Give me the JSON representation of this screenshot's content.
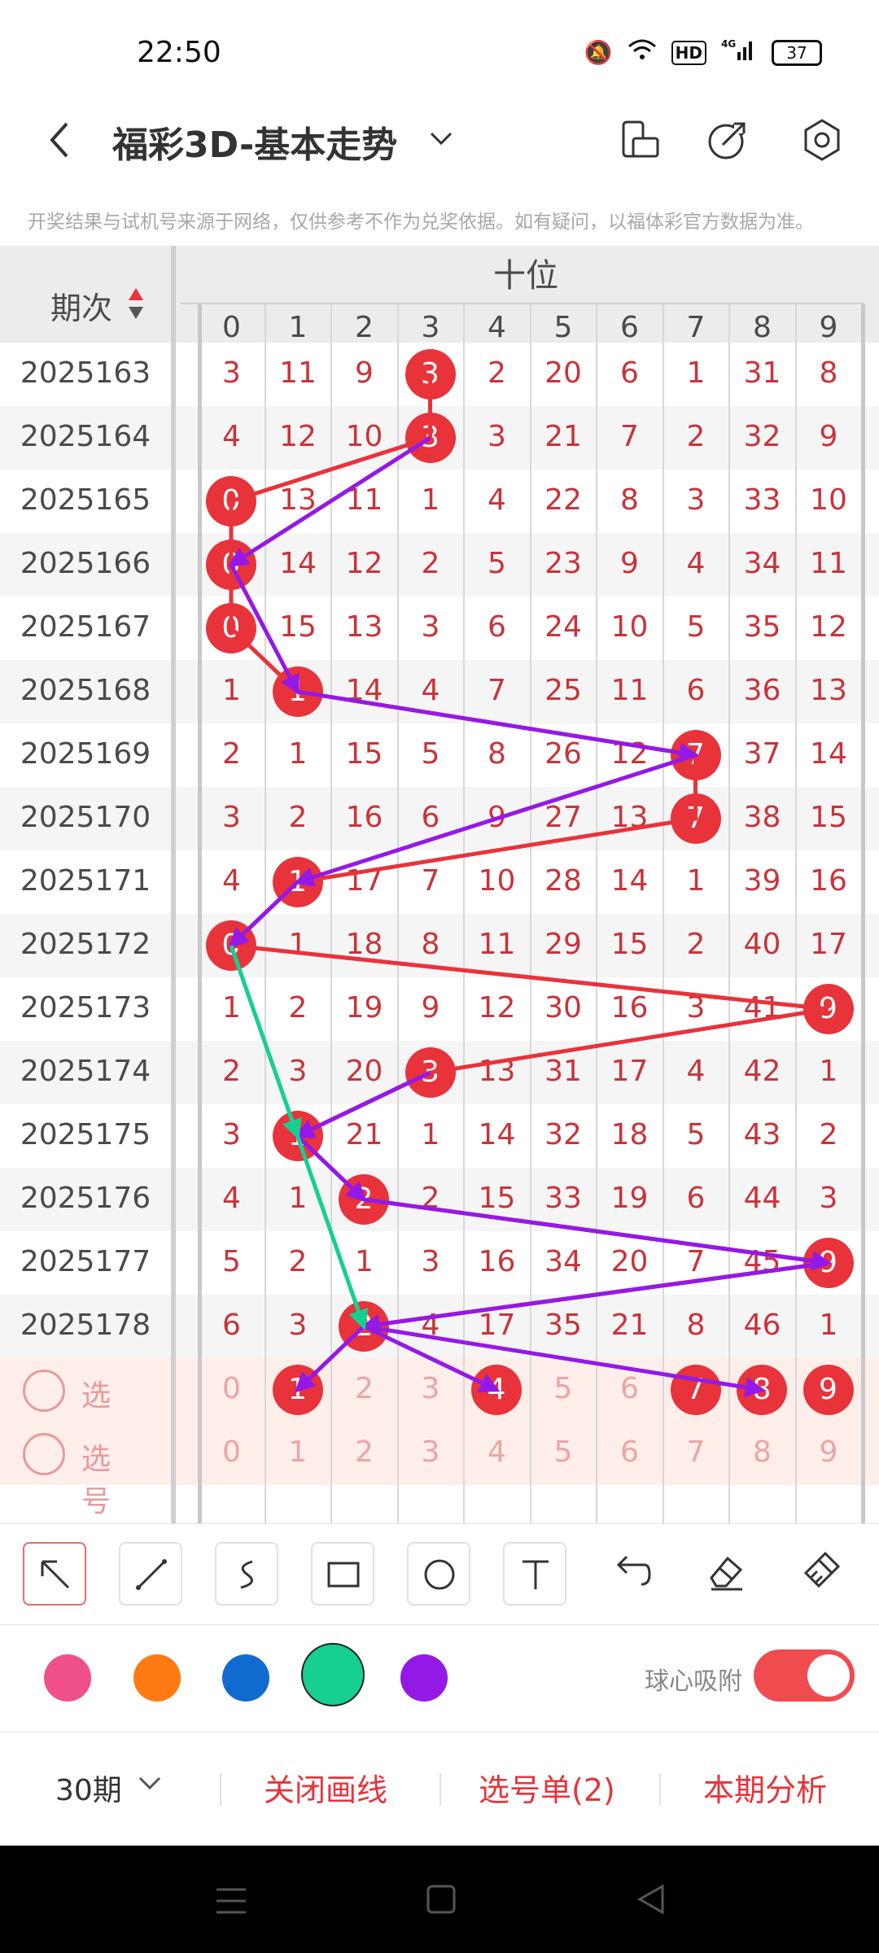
{
  "status": {
    "time": "22:50",
    "hd": "HD",
    "network": "4G",
    "battery": "37"
  },
  "header": {
    "title": "福彩3D-基本走势",
    "back_icon": "back-arrow-icon",
    "dropdown_icon": "chevron-down-icon"
  },
  "notice": "开奖结果与试机号来源于网络，仅供参考不作为兑奖依据。如有疑问，以福体彩官方数据为准。",
  "table": {
    "issue_header": "期次",
    "group_header": "十位",
    "digit_headers": [
      "0",
      "1",
      "2",
      "3",
      "4",
      "5",
      "6",
      "7",
      "8",
      "9"
    ],
    "rows": [
      {
        "issue": "2025163",
        "cells": [
          "3",
          "11",
          "9",
          "3",
          "2",
          "20",
          "6",
          "1",
          "31",
          "8"
        ],
        "hit": 3
      },
      {
        "issue": "2025164",
        "cells": [
          "4",
          "12",
          "10",
          "3",
          "3",
          "21",
          "7",
          "2",
          "32",
          "9"
        ],
        "hit": 3
      },
      {
        "issue": "2025165",
        "cells": [
          "0",
          "13",
          "11",
          "1",
          "4",
          "22",
          "8",
          "3",
          "33",
          "10"
        ],
        "hit": 0
      },
      {
        "issue": "2025166",
        "cells": [
          "0",
          "14",
          "12",
          "2",
          "5",
          "23",
          "9",
          "4",
          "34",
          "11"
        ],
        "hit": 0
      },
      {
        "issue": "2025167",
        "cells": [
          "0",
          "15",
          "13",
          "3",
          "6",
          "24",
          "10",
          "5",
          "35",
          "12"
        ],
        "hit": 0
      },
      {
        "issue": "2025168",
        "cells": [
          "1",
          "1",
          "14",
          "4",
          "7",
          "25",
          "11",
          "6",
          "36",
          "13"
        ],
        "hit": 1
      },
      {
        "issue": "2025169",
        "cells": [
          "2",
          "1",
          "15",
          "5",
          "8",
          "26",
          "12",
          "7",
          "37",
          "14"
        ],
        "hit": 7
      },
      {
        "issue": "2025170",
        "cells": [
          "3",
          "2",
          "16",
          "6",
          "9",
          "27",
          "13",
          "7",
          "38",
          "15"
        ],
        "hit": 7
      },
      {
        "issue": "2025171",
        "cells": [
          "4",
          "1",
          "17",
          "7",
          "10",
          "28",
          "14",
          "1",
          "39",
          "16"
        ],
        "hit": 1
      },
      {
        "issue": "2025172",
        "cells": [
          "0",
          "1",
          "18",
          "8",
          "11",
          "29",
          "15",
          "2",
          "40",
          "17"
        ],
        "hit": 0
      },
      {
        "issue": "2025173",
        "cells": [
          "1",
          "2",
          "19",
          "9",
          "12",
          "30",
          "16",
          "3",
          "41",
          "9"
        ],
        "hit": 9
      },
      {
        "issue": "2025174",
        "cells": [
          "2",
          "3",
          "20",
          "3",
          "13",
          "31",
          "17",
          "4",
          "42",
          "1"
        ],
        "hit": 3
      },
      {
        "issue": "2025175",
        "cells": [
          "3",
          "1",
          "21",
          "1",
          "14",
          "32",
          "18",
          "5",
          "43",
          "2"
        ],
        "hit": 1
      },
      {
        "issue": "2025176",
        "cells": [
          "4",
          "1",
          "2",
          "2",
          "15",
          "33",
          "19",
          "6",
          "44",
          "3"
        ],
        "hit": 2
      },
      {
        "issue": "2025177",
        "cells": [
          "5",
          "2",
          "1",
          "3",
          "16",
          "34",
          "20",
          "7",
          "45",
          "9"
        ],
        "hit": 9
      },
      {
        "issue": "2025178",
        "cells": [
          "6",
          "3",
          "2",
          "4",
          "17",
          "35",
          "21",
          "8",
          "46",
          "1"
        ],
        "hit": 2
      }
    ],
    "select_rows": [
      {
        "label": "选号",
        "cells": [
          "0",
          "1",
          "2",
          "3",
          "4",
          "5",
          "6",
          "7",
          "8",
          "9"
        ],
        "selected": [
          1,
          4,
          7,
          8,
          9
        ]
      },
      {
        "label": "选号",
        "cells": [
          "0",
          "1",
          "2",
          "3",
          "4",
          "5",
          "6",
          "7",
          "8",
          "9"
        ],
        "selected": []
      }
    ]
  },
  "tools": [
    "arrow-tool-icon",
    "line-tool-icon",
    "freehand-tool-icon",
    "rectangle-tool-icon",
    "circle-tool-icon",
    "text-tool-icon",
    "undo-icon",
    "eraser-icon",
    "clear-icon"
  ],
  "colors": {
    "swatches": [
      "#f0508a",
      "#ff7a12",
      "#0f6bd0",
      "#16cf92",
      "#9519e6"
    ],
    "selected": "#16cf92",
    "accent": "#e8333a"
  },
  "snap": {
    "label": "球心吸附",
    "on": true
  },
  "bottom": {
    "period": "30期",
    "close_lines": "关闭画线",
    "selection_list": "选号单(2)",
    "analysis": "本期分析"
  }
}
